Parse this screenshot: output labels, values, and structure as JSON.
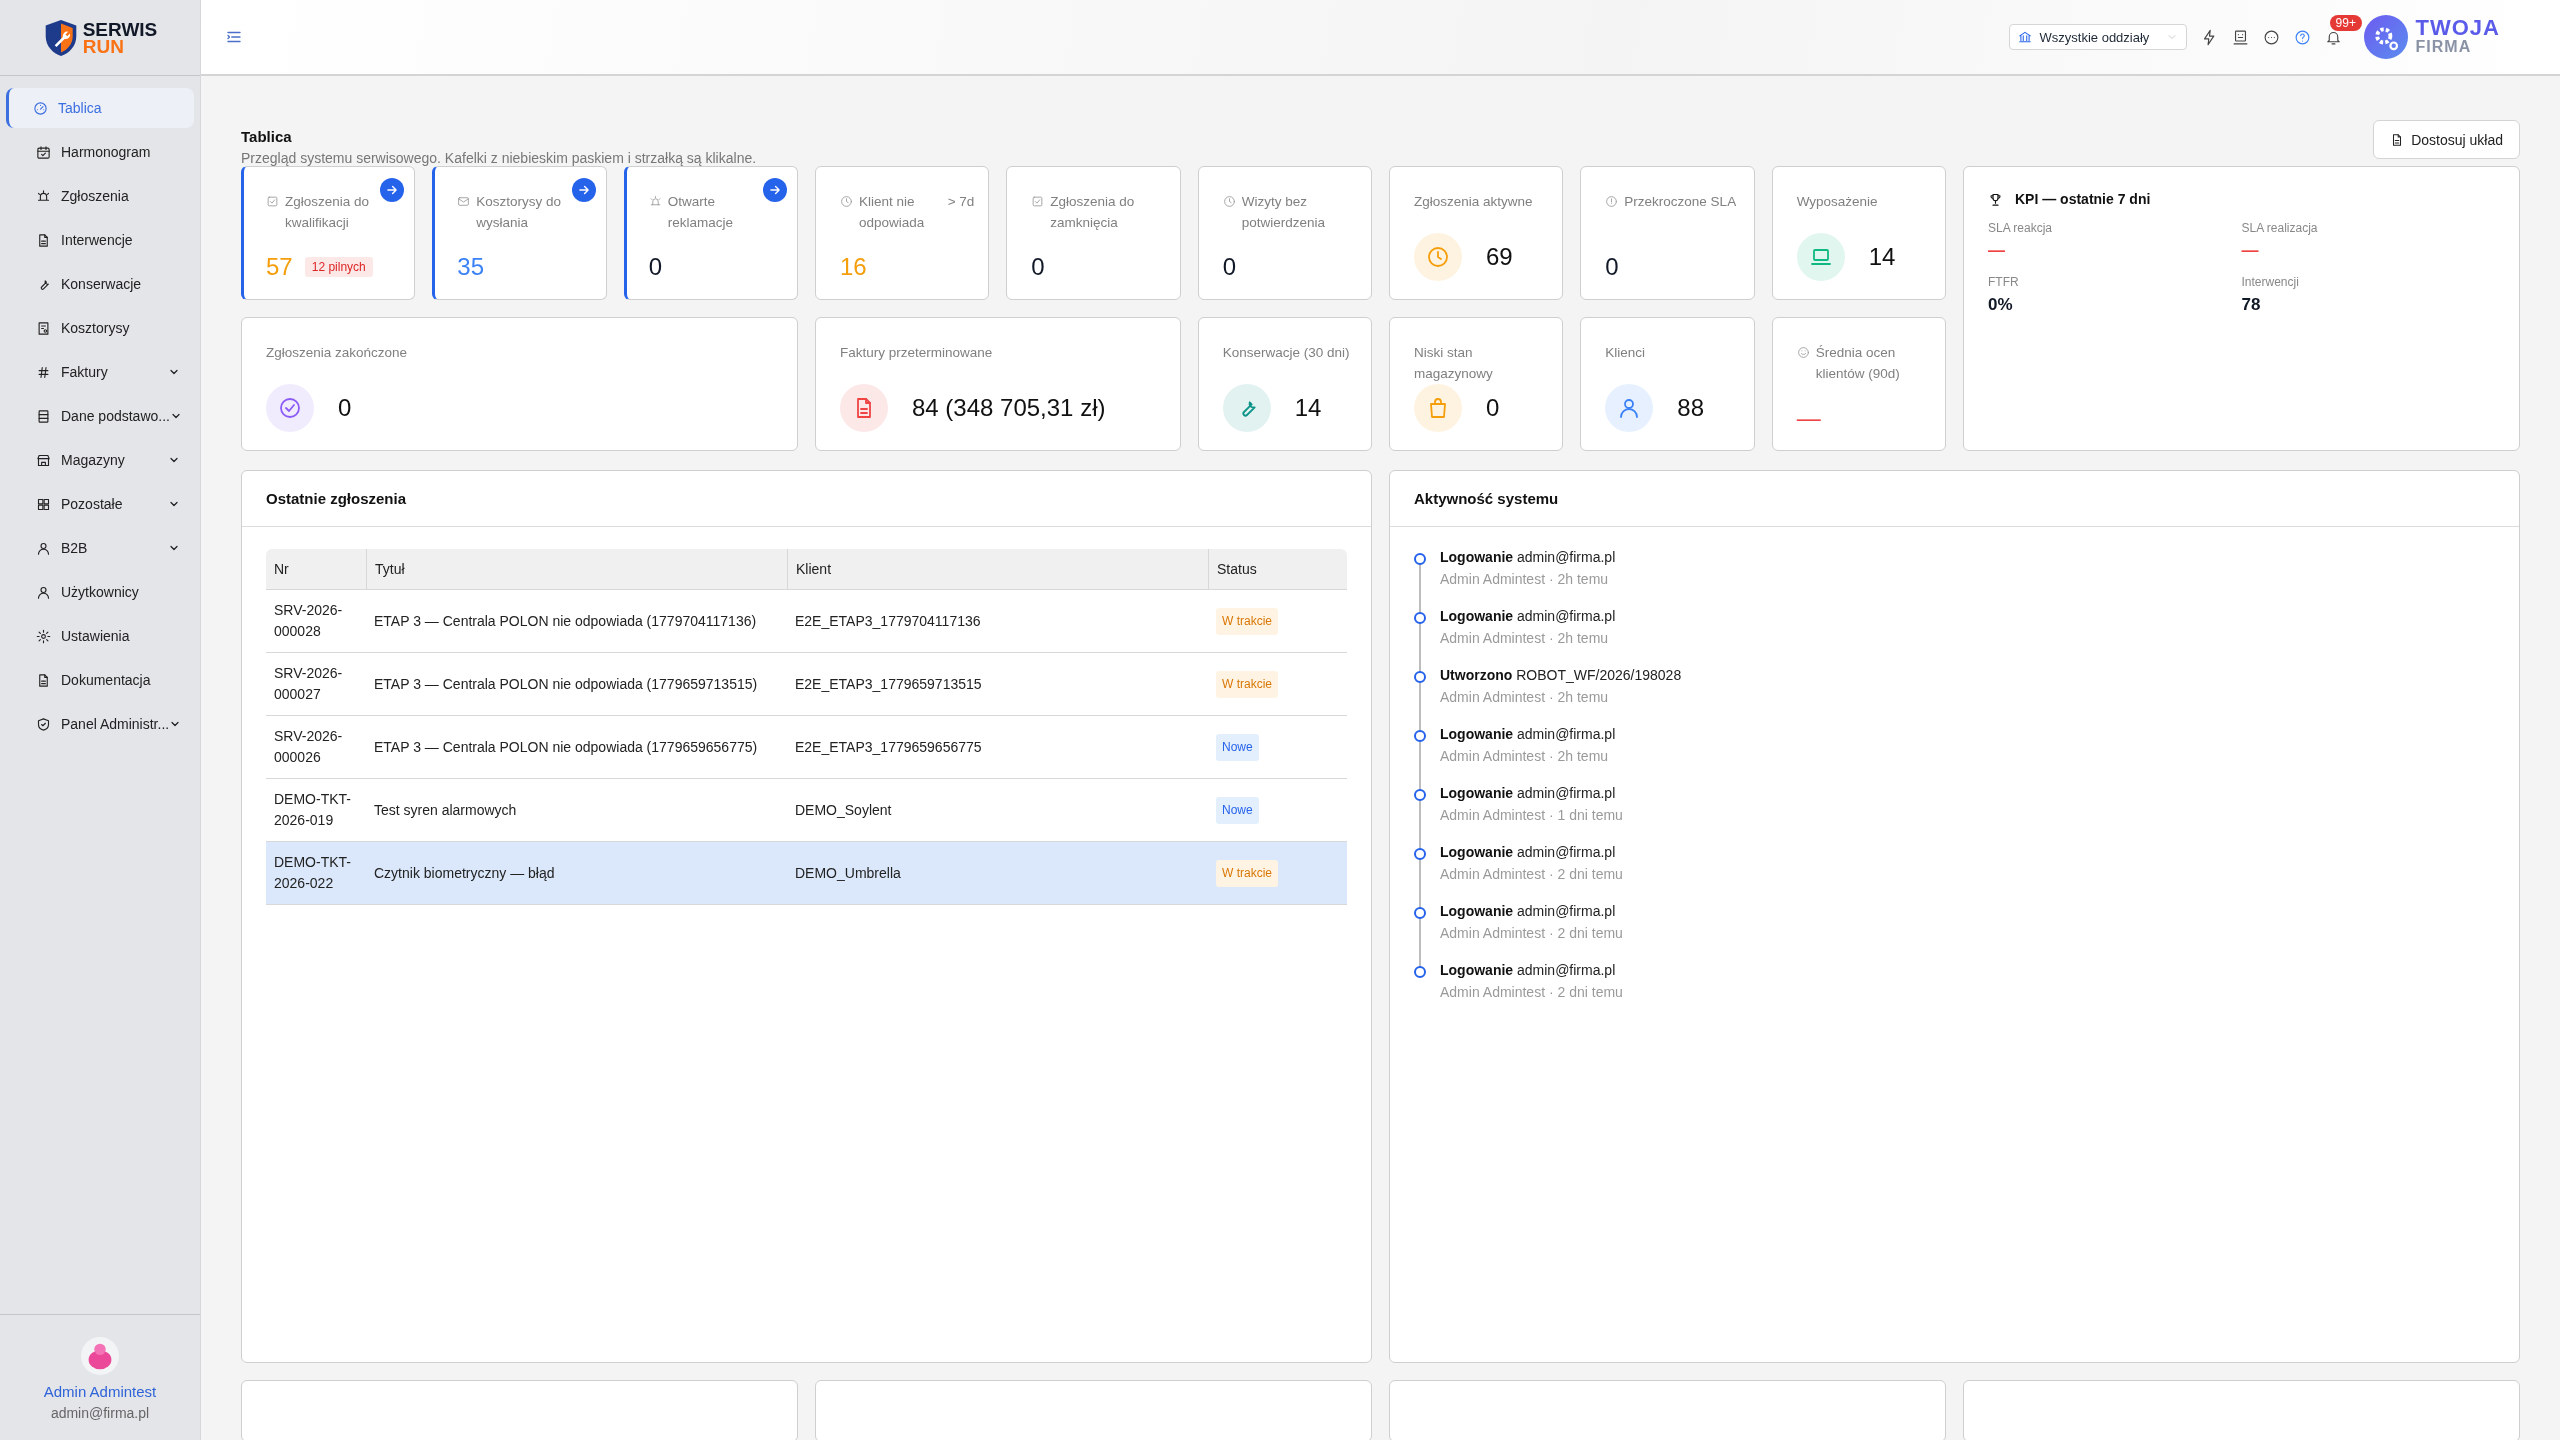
{
  "brand": {
    "line1": "SERWIS",
    "line2": "RUN"
  },
  "sidebar": {
    "items": [
      {
        "label": "Tablica",
        "selected": true,
        "expandable": false
      },
      {
        "label": "Harmonogram",
        "selected": false,
        "expandable": false
      },
      {
        "label": "Zgłoszenia",
        "selected": false,
        "expandable": false
      },
      {
        "label": "Interwencje",
        "selected": false,
        "expandable": false
      },
      {
        "label": "Konserwacje",
        "selected": false,
        "expandable": false
      },
      {
        "label": "Kosztorysy",
        "selected": false,
        "expandable": false
      },
      {
        "label": "Faktury",
        "selected": false,
        "expandable": true
      },
      {
        "label": "Dane podstawo...",
        "selected": false,
        "expandable": true
      },
      {
        "label": "Magazyny",
        "selected": false,
        "expandable": true
      },
      {
        "label": "Pozostałe",
        "selected": false,
        "expandable": true
      },
      {
        "label": "B2B",
        "selected": false,
        "expandable": true
      },
      {
        "label": "Użytkownicy",
        "selected": false,
        "expandable": false
      },
      {
        "label": "Ustawienia",
        "selected": false,
        "expandable": false
      },
      {
        "label": "Dokumentacja",
        "selected": false,
        "expandable": false
      },
      {
        "label": "Panel Administr...",
        "selected": false,
        "expandable": true
      }
    ]
  },
  "user": {
    "name": "Admin Admintest",
    "email": "admin@firma.pl"
  },
  "header": {
    "branch_select": {
      "value": "Wszystkie oddziały"
    },
    "notification_badge": "99+",
    "company": {
      "line1": "TWOJA",
      "line2": "FIRMA"
    }
  },
  "page": {
    "title": "Tablica",
    "subtitle": "Przegląd systemu serwisowego. Kafelki z niebieskim paskiem i strzałką są klikalne.",
    "customize_button": "Dostosuj układ"
  },
  "tiles": [
    {
      "kind": "stat",
      "label": "Zgłoszenia do kwalifikacji",
      "value": "57",
      "color": "#f59e0b",
      "clickable": true,
      "badge": "12 pilnych"
    },
    {
      "kind": "stat",
      "label": "Kosztorysy do wysłania",
      "value": "35",
      "color": "#3b82f6",
      "clickable": true
    },
    {
      "kind": "stat",
      "label": "Otwarte reklamacje",
      "value": "0",
      "color": "#111827",
      "clickable": true
    },
    {
      "kind": "stat",
      "label": "Klient nie odpowiada",
      "suffix": "> 7d",
      "value": "16",
      "color": "#f59e0b",
      "clickable": false
    },
    {
      "kind": "stat",
      "label": "Zgłoszenia do zamknięcia",
      "value": "0",
      "color": "#111827",
      "clickable": false
    },
    {
      "kind": "stat",
      "label": "Wizyty bez potwierdzenia",
      "value": "0",
      "color": "#111827",
      "clickable": false
    },
    {
      "kind": "icon_stat",
      "label": "Zgłoszenia aktywne",
      "value": "69",
      "color": "#f59e0b",
      "clickable": false
    },
    {
      "kind": "stat",
      "label": "Przekroczone SLA",
      "value": "0",
      "color": "#111827",
      "clickable": false
    },
    {
      "kind": "icon_stat",
      "label": "Wyposażenie",
      "value": "14",
      "color": "#10b981",
      "clickable": false
    },
    {
      "kind": "icon_stat",
      "label": "Zgłoszenia zakończone",
      "value": "0",
      "color": "#8b5cf6",
      "clickable": false
    },
    {
      "kind": "icon_stat",
      "label": "Faktury przeterminowane",
      "value": "84 (348 705,31 zł)",
      "color": "#ef4444",
      "clickable": false
    },
    {
      "kind": "icon_stat",
      "label": "Konserwacje (30 dni)",
      "value": "14",
      "color": "#0d9488",
      "clickable": false
    },
    {
      "kind": "icon_stat",
      "label": "Niski stan magazynowy",
      "value": "0",
      "color": "#f59e0b",
      "clickable": false
    },
    {
      "kind": "icon_stat",
      "label": "Klienci",
      "value": "88",
      "color": "#3b82f6",
      "clickable": false
    },
    {
      "kind": "stat",
      "label": "Średnia ocen klientów (90d)",
      "value": "—",
      "color": "#ef4444",
      "clickable": false
    }
  ],
  "kpi": {
    "title": "KPI — ostatnie 7 dni",
    "metrics": [
      {
        "label": "SLA reakcja",
        "value": "—",
        "color": "#ef4444"
      },
      {
        "label": "SLA realizacja",
        "value": "—",
        "color": "#ef4444"
      },
      {
        "label": "FTFR",
        "value": "0%",
        "color": "#111827"
      },
      {
        "label": "Interwencji",
        "value": "78",
        "color": "#111827"
      }
    ]
  },
  "recent_tickets": {
    "title": "Ostatnie zgłoszenia",
    "columns": [
      "Nr",
      "Tytuł",
      "Klient",
      "Status"
    ],
    "rows": [
      {
        "nr": "SRV-2026-000028",
        "title": "ETAP 3 — Centrala POLON nie odpowiada (1779704117136)",
        "client": "E2E_ETAP3_1779704117136",
        "status": {
          "label": "W trakcie",
          "kind": "in_progress"
        },
        "selected": false
      },
      {
        "nr": "SRV-2026-000027",
        "title": "ETAP 3 — Centrala POLON nie odpowiada (1779659713515)",
        "client": "E2E_ETAP3_1779659713515",
        "status": {
          "label": "W trakcie",
          "kind": "in_progress"
        },
        "selected": false
      },
      {
        "nr": "SRV-2026-000026",
        "title": "ETAP 3 — Centrala POLON nie odpowiada (1779659656775)",
        "client": "E2E_ETAP3_1779659656775",
        "status": {
          "label": "Nowe",
          "kind": "new"
        },
        "selected": false
      },
      {
        "nr": "DEMO-TKT-2026-019",
        "title": "Test syren alarmowych",
        "client": "DEMO_Soylent",
        "status": {
          "label": "Nowe",
          "kind": "new"
        },
        "selected": false
      },
      {
        "nr": "DEMO-TKT-2026-022",
        "title": "Czytnik biometryczny — błąd",
        "client": "DEMO_Umbrella",
        "status": {
          "label": "W trakcie",
          "kind": "in_progress"
        },
        "selected": true
      }
    ]
  },
  "activity": {
    "title": "Aktywność systemu",
    "items": [
      {
        "text": "**Logowanie** admin@firma.pl",
        "meta": "Admin Admintest · 2h temu"
      },
      {
        "text": "**Logowanie** admin@firma.pl",
        "meta": "Admin Admintest · 2h temu"
      },
      {
        "text": "**Utworzono** ROBOT_WF/2026/198028",
        "meta": "Admin Admintest · 2h temu"
      },
      {
        "text": "**Logowanie** admin@firma.pl",
        "meta": "Admin Admintest · 2h temu"
      },
      {
        "text": "**Logowanie** admin@firma.pl",
        "meta": "Admin Admintest · 1 dni temu"
      },
      {
        "text": "**Logowanie** admin@firma.pl",
        "meta": "Admin Admintest · 2 dni temu"
      },
      {
        "text": "**Logowanie** admin@firma.pl",
        "meta": "Admin Admintest · 2 dni temu"
      },
      {
        "text": "**Logowanie** admin@firma.pl",
        "meta": "Admin Admintest · 2 dni temu"
      }
    ]
  }
}
